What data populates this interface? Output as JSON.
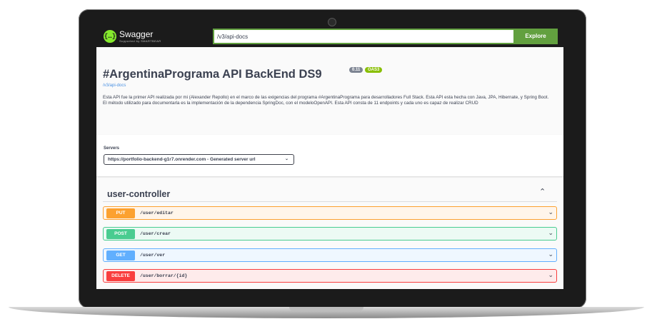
{
  "topbar": {
    "logo_glyph": "{…}",
    "logo_name": "Swagger",
    "logo_sub": "Supported by SMARTBEAR",
    "url_value": "/v3/api-docs",
    "explore_label": "Explore"
  },
  "info": {
    "title": "#ArgentinaPrograma API BackEnd DS9",
    "version": "0.11",
    "oas": "OAS3",
    "link": "/v3/api-docs",
    "description": "Esta API fue la primer API realizada por mi (Alexander Repollo) en el marco de las exigencias del programa #ArgentinaPrograma para desarrolladores Full Stack. Esta API esta hecha con Java, JPA, Hibernate, y Spring Boot. El método utilizado para documentarla es la implementación de la dependencia SpringDoc, con el modeloOpenAPI. Esta API consta de 11 endpoints y cada uno es capaz de realizar CRUD"
  },
  "servers": {
    "label": "Servers",
    "selected": "https://portfolio-backend-g1r7.onrender.com - Generated server url"
  },
  "tag": {
    "name": "user-controller",
    "chevron": "⌃"
  },
  "operations": [
    {
      "method": "PUT",
      "path": "/user/editar"
    },
    {
      "method": "POST",
      "path": "/user/crear"
    },
    {
      "method": "GET",
      "path": "/user/ver"
    },
    {
      "method": "DELETE",
      "path": "/user/borrar/{id}"
    }
  ],
  "icons": {
    "op_chevron": "⌄",
    "select_arrow": "⌄"
  },
  "colors": {
    "put": "#fca130",
    "post": "#49cc90",
    "get": "#61affe",
    "delete": "#f93e3e",
    "accent": "#62a03f"
  }
}
